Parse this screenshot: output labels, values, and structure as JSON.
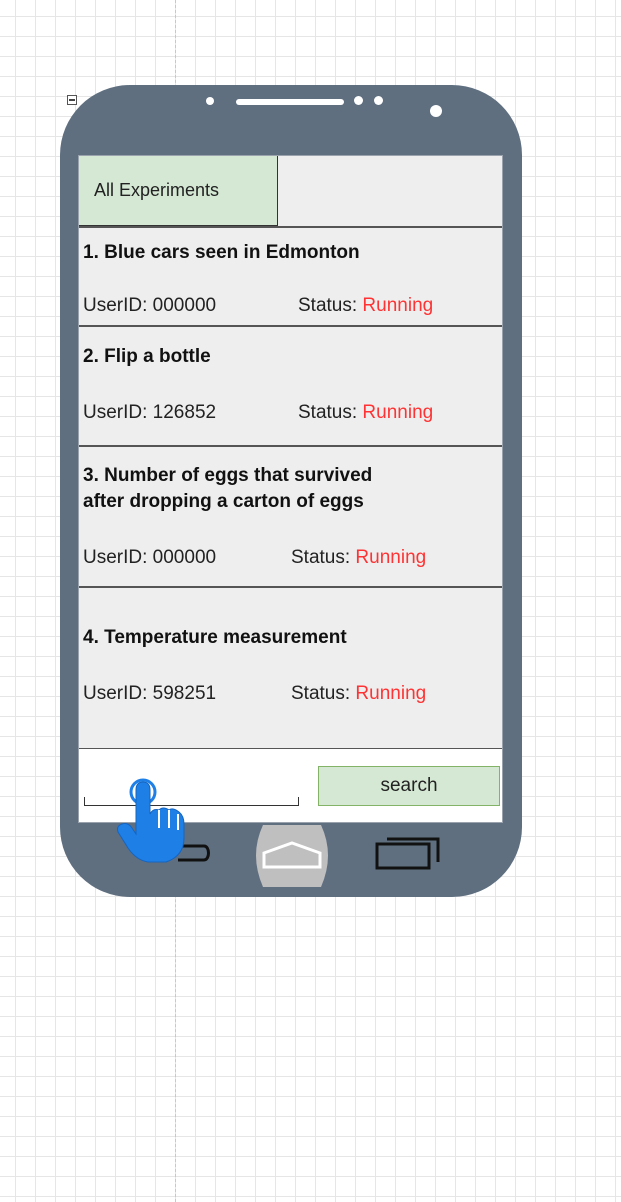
{
  "tabs": [
    {
      "label": "All Experiments",
      "active": true
    }
  ],
  "experiments": [
    {
      "title": "1. Blue cars seen in Edmonton",
      "user_label": "UserID: 000000",
      "status_label": "Status: ",
      "status_value": "Running"
    },
    {
      "title": "2. Flip a bottle",
      "user_label": "UserID: 126852",
      "status_label": "Status: ",
      "status_value": "Running"
    },
    {
      "title_line1": "3. Number of eggs that survived",
      "title_line2": "after dropping a carton of eggs",
      "user_label": "UserID: 000000",
      "status_label": "Status: ",
      "status_value": "Running"
    },
    {
      "title": "4. Temperature measurement",
      "user_label": "UserID: 598251",
      "status_label": "Status: ",
      "status_value": "Running"
    }
  ],
  "search": {
    "button_label": "search",
    "value": ""
  },
  "nav": {
    "back": "back-icon",
    "home": "home-icon",
    "recent": "recent-apps-icon"
  },
  "colors": {
    "phone_body": "#5f6f80",
    "tab_active": "#d5e8d4",
    "status_running": "#ff3333",
    "search_button": "#d5e8d4"
  }
}
